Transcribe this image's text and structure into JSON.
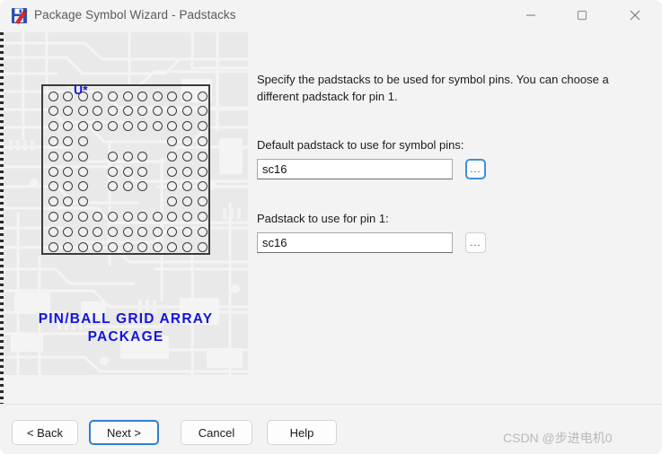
{
  "window": {
    "title": "Package Symbol Wizard - Padstacks",
    "icon_name": "wizard-app-icon",
    "controls": {
      "minimize": "—",
      "maximize": "□",
      "close": "✕"
    }
  },
  "illustration": {
    "caption_line1": "PIN/BALL GRID ARRAY",
    "caption_line2": "PACKAGE",
    "chip_label": "U*",
    "grid": {
      "rows": 11,
      "cols": 11,
      "pattern": [
        [
          1,
          1,
          1,
          1,
          1,
          1,
          1,
          1,
          1,
          1,
          1
        ],
        [
          1,
          1,
          1,
          1,
          1,
          1,
          1,
          1,
          1,
          1,
          1
        ],
        [
          1,
          1,
          1,
          1,
          1,
          1,
          1,
          1,
          1,
          1,
          1
        ],
        [
          1,
          1,
          1,
          0,
          0,
          0,
          0,
          0,
          1,
          1,
          1
        ],
        [
          1,
          1,
          1,
          0,
          1,
          1,
          1,
          0,
          1,
          1,
          1
        ],
        [
          1,
          1,
          1,
          0,
          1,
          1,
          1,
          0,
          1,
          1,
          1
        ],
        [
          1,
          1,
          1,
          0,
          1,
          1,
          1,
          0,
          1,
          1,
          1
        ],
        [
          1,
          1,
          1,
          0,
          0,
          0,
          0,
          0,
          1,
          1,
          1
        ],
        [
          1,
          1,
          1,
          1,
          1,
          1,
          1,
          1,
          1,
          1,
          1
        ],
        [
          1,
          1,
          1,
          1,
          1,
          1,
          1,
          1,
          1,
          1,
          1
        ],
        [
          1,
          1,
          1,
          1,
          1,
          1,
          1,
          1,
          1,
          1,
          1
        ]
      ]
    },
    "colors": {
      "caption": "#1414dc",
      "chip_label": "#1414e0",
      "panel_bg": "#e8e8e8"
    }
  },
  "main": {
    "instructions": "Specify the padstacks to be used for symbol pins. You can choose a different padstack for pin 1.",
    "fields": [
      {
        "label": "Default padstack to use for symbol pins:",
        "value": "sc16",
        "placeholder": "",
        "browse_label": "...",
        "focused": true
      },
      {
        "label": "Padstack to use for pin 1:",
        "value": "sc16",
        "placeholder": "",
        "browse_label": "...",
        "focused": false
      }
    ]
  },
  "footer": {
    "buttons": [
      {
        "label": "< Back",
        "name": "back-button",
        "default": false
      },
      {
        "label": "Next >",
        "name": "next-button",
        "default": true
      },
      {
        "label": "Cancel",
        "name": "cancel-button",
        "default": false
      },
      {
        "label": "Help",
        "name": "help-button",
        "default": false
      }
    ],
    "accent_color": "#2f7fd0"
  },
  "watermark": "CSDN @步进电机0"
}
